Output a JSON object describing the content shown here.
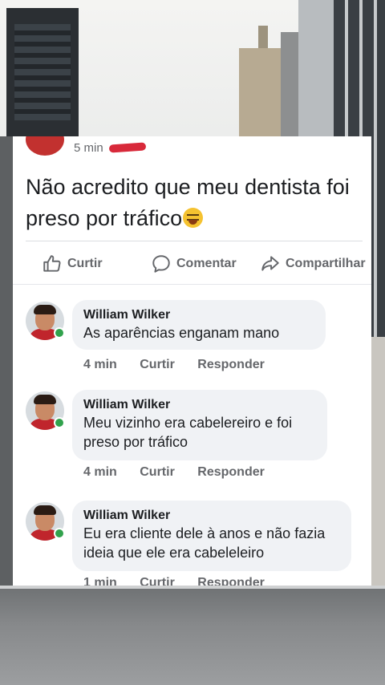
{
  "post": {
    "time": "5 min",
    "text": "Não acredito que meu dentista foi preso por tráfico",
    "emoji": "tired-face-emoji"
  },
  "actions": {
    "like": "Curtir",
    "comment": "Comentar",
    "share": "Compartilhar"
  },
  "comments": [
    {
      "author": "William Wilker",
      "text": "As aparências enganam mano",
      "time": "4 min",
      "like": "Curtir",
      "reply": "Responder"
    },
    {
      "author": "William Wilker",
      "text": "Meu vizinho era cabelereiro e foi preso por tráfico",
      "time": "4 min",
      "like": "Curtir",
      "reply": "Responder"
    },
    {
      "author": "William Wilker",
      "text": "Eu era cliente dele à anos e não fazia ideia que ele era cabeleleiro",
      "time": "1 min",
      "like": "Curtir",
      "reply": "Responder"
    }
  ],
  "colors": {
    "card": "#ffffff",
    "bubble": "#f0f2f5",
    "muted": "#65676b",
    "online": "#31a24c"
  }
}
